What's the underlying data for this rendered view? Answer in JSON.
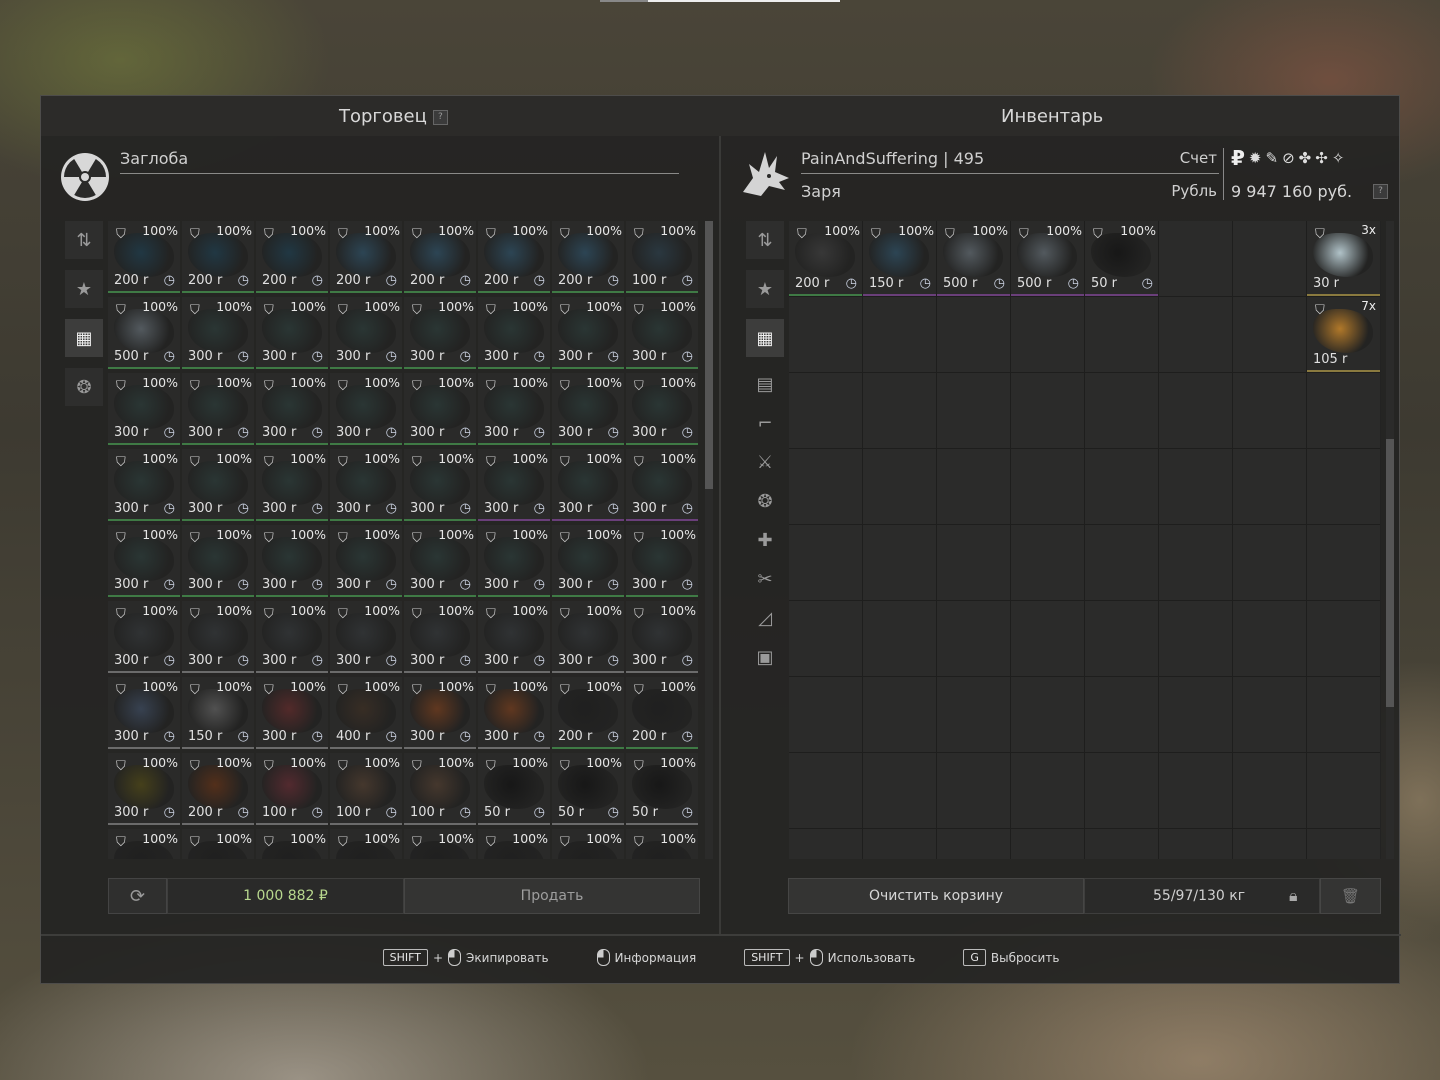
{
  "trader": {
    "title": "Торговец",
    "help": "?",
    "name": "Заглоба",
    "money": "1 000 882",
    "money_symbol": "₽",
    "sell_label": "Продать",
    "rows": [
      [
        {
          "c": "100%",
          "p": "200 r",
          "col": "#1f3a48",
          "b": "b-green"
        },
        {
          "c": "100%",
          "p": "200 r",
          "col": "#1f3a48",
          "b": "b-green"
        },
        {
          "c": "100%",
          "p": "200 r",
          "col": "#1f3a48",
          "b": "b-green"
        },
        {
          "c": "100%",
          "p": "200 r",
          "col": "#2d4a5c",
          "b": "b-green"
        },
        {
          "c": "100%",
          "p": "200 r",
          "col": "#2d4a5c",
          "b": "b-green"
        },
        {
          "c": "100%",
          "p": "200 r",
          "col": "#2d4a5c",
          "b": "b-green"
        },
        {
          "c": "100%",
          "p": "200 r",
          "col": "#2d4a5c",
          "b": "b-green"
        },
        {
          "c": "100%",
          "p": "100 r",
          "col": "#2a3a44",
          "b": "b-green"
        }
      ],
      [
        {
          "c": "100%",
          "p": "500 r",
          "col": "#5a6268",
          "b": "b-green"
        },
        {
          "c": "100%",
          "p": "300 r",
          "col": "#2a3836",
          "b": "b-green"
        },
        {
          "c": "100%",
          "p": "300 r",
          "col": "#2a3836",
          "b": "b-green"
        },
        {
          "c": "100%",
          "p": "300 r",
          "col": "#2a3836",
          "b": "b-green"
        },
        {
          "c": "100%",
          "p": "300 r",
          "col": "#2a3836",
          "b": "b-green"
        },
        {
          "c": "100%",
          "p": "300 r",
          "col": "#2a3836",
          "b": "b-green"
        },
        {
          "c": "100%",
          "p": "300 r",
          "col": "#2a3836",
          "b": "b-green"
        },
        {
          "c": "100%",
          "p": "300 r",
          "col": "#2a3836",
          "b": "b-green"
        }
      ],
      [
        {
          "c": "100%",
          "p": "300 r",
          "col": "#2a3836",
          "b": "b-green"
        },
        {
          "c": "100%",
          "p": "300 r",
          "col": "#2a3836",
          "b": "b-green"
        },
        {
          "c": "100%",
          "p": "300 r",
          "col": "#2a3836",
          "b": "b-green"
        },
        {
          "c": "100%",
          "p": "300 r",
          "col": "#2a3836",
          "b": "b-green"
        },
        {
          "c": "100%",
          "p": "300 r",
          "col": "#2a3836",
          "b": "b-green"
        },
        {
          "c": "100%",
          "p": "300 r",
          "col": "#2a3836",
          "b": "b-green"
        },
        {
          "c": "100%",
          "p": "300 r",
          "col": "#2a3836",
          "b": "b-green"
        },
        {
          "c": "100%",
          "p": "300 r",
          "col": "#2a3836",
          "b": "b-green"
        }
      ],
      [
        {
          "c": "100%",
          "p": "300 r",
          "col": "#2a3836",
          "b": "b-green"
        },
        {
          "c": "100%",
          "p": "300 r",
          "col": "#2a3836",
          "b": "b-green"
        },
        {
          "c": "100%",
          "p": "300 r",
          "col": "#2a3836",
          "b": "b-green"
        },
        {
          "c": "100%",
          "p": "300 r",
          "col": "#2a3836",
          "b": "b-green"
        },
        {
          "c": "100%",
          "p": "300 r",
          "col": "#2a3836",
          "b": "b-green"
        },
        {
          "c": "100%",
          "p": "300 r",
          "col": "#2a3836",
          "b": "b-purple"
        },
        {
          "c": "100%",
          "p": "300 r",
          "col": "#2a3836",
          "b": "b-purple"
        },
        {
          "c": "100%",
          "p": "300 r",
          "col": "#2a3836",
          "b": "b-purple"
        }
      ],
      [
        {
          "c": "100%",
          "p": "300 r",
          "col": "#2a3836",
          "b": "b-green"
        },
        {
          "c": "100%",
          "p": "300 r",
          "col": "#2a3836",
          "b": "b-green"
        },
        {
          "c": "100%",
          "p": "300 r",
          "col": "#2a3836",
          "b": "b-green"
        },
        {
          "c": "100%",
          "p": "300 r",
          "col": "#2a3836",
          "b": "b-green"
        },
        {
          "c": "100%",
          "p": "300 r",
          "col": "#2a3836",
          "b": "b-green"
        },
        {
          "c": "100%",
          "p": "300 r",
          "col": "#2a3836",
          "b": "b-green"
        },
        {
          "c": "100%",
          "p": "300 r",
          "col": "#2a3836",
          "b": "b-green"
        },
        {
          "c": "100%",
          "p": "300 r",
          "col": "#2a3836",
          "b": "b-green"
        }
      ],
      [
        {
          "c": "100%",
          "p": "300 r",
          "col": "#313436",
          "b": ""
        },
        {
          "c": "100%",
          "p": "300 r",
          "col": "#313436",
          "b": ""
        },
        {
          "c": "100%",
          "p": "300 r",
          "col": "#313436",
          "b": ""
        },
        {
          "c": "100%",
          "p": "300 r",
          "col": "#313436",
          "b": ""
        },
        {
          "c": "100%",
          "p": "300 r",
          "col": "#313436",
          "b": ""
        },
        {
          "c": "100%",
          "p": "300 r",
          "col": "#313436",
          "b": ""
        },
        {
          "c": "100%",
          "p": "300 r",
          "col": "#313436",
          "b": ""
        },
        {
          "c": "100%",
          "p": "300 r",
          "col": "#313436",
          "b": ""
        }
      ],
      [
        {
          "c": "100%",
          "p": "300 r",
          "col": "#3a4658",
          "b": ""
        },
        {
          "c": "100%",
          "p": "150 r",
          "col": "#585858",
          "b": ""
        },
        {
          "c": "100%",
          "p": "300 r",
          "col": "#5a2a2a",
          "b": ""
        },
        {
          "c": "100%",
          "p": "400 r",
          "col": "#3a2e24",
          "b": ""
        },
        {
          "c": "100%",
          "p": "300 r",
          "col": "#6a3a1e",
          "b": ""
        },
        {
          "c": "100%",
          "p": "300 r",
          "col": "#6a3a1e",
          "b": ""
        },
        {
          "c": "100%",
          "p": "200 r",
          "col": "#1e1e1e",
          "b": "b-green"
        },
        {
          "c": "100%",
          "p": "200 r",
          "col": "#1e1e1e",
          "b": "b-green"
        }
      ],
      [
        {
          "c": "100%",
          "p": "300 r",
          "col": "#4a4418",
          "b": ""
        },
        {
          "c": "100%",
          "p": "200 r",
          "col": "#5a3018",
          "b": ""
        },
        {
          "c": "100%",
          "p": "100 r",
          "col": "#5a2a30",
          "b": ""
        },
        {
          "c": "100%",
          "p": "100 r",
          "col": "#4a3a2e",
          "b": ""
        },
        {
          "c": "100%",
          "p": "100 r",
          "col": "#4a3a2e",
          "b": ""
        },
        {
          "c": "100%",
          "p": "50 r",
          "col": "#141414",
          "b": ""
        },
        {
          "c": "100%",
          "p": "50 r",
          "col": "#141414",
          "b": ""
        },
        {
          "c": "100%",
          "p": "50 r",
          "col": "#141414",
          "b": ""
        }
      ],
      [
        {
          "c": "100%",
          "p": "",
          "col": "#1e1e1e",
          "b": ""
        },
        {
          "c": "100%",
          "p": "",
          "col": "#1e1e1e",
          "b": ""
        },
        {
          "c": "100%",
          "p": "",
          "col": "#1e1e1e",
          "b": ""
        },
        {
          "c": "100%",
          "p": "",
          "col": "#1e1e1e",
          "b": ""
        },
        {
          "c": "100%",
          "p": "",
          "col": "#1e1e1e",
          "b": ""
        },
        {
          "c": "100%",
          "p": "",
          "col": "#1e1e1e",
          "b": ""
        },
        {
          "c": "100%",
          "p": "",
          "col": "#1e1e1e",
          "b": ""
        },
        {
          "c": "100%",
          "p": "",
          "col": "#1e1e1e",
          "b": ""
        }
      ]
    ]
  },
  "inventory": {
    "title": "Инвентарь",
    "player": "PainAndSuffering | 495",
    "faction": "Заря",
    "account_label": "Счет",
    "currency_label": "Рубль",
    "balance": "9 947 160 руб.",
    "help": "?",
    "currency_icons": [
      "₽",
      "✹",
      "✎",
      "⊘",
      "✤",
      "✣",
      "✧"
    ],
    "items": [
      {
        "slot": 0,
        "c": "100%",
        "p": "200 r",
        "col": "#3a3a3a",
        "b": "b-green"
      },
      {
        "slot": 1,
        "c": "100%",
        "p": "150 r",
        "col": "#2d4a5c",
        "b": "b-purple"
      },
      {
        "slot": 2,
        "c": "100%",
        "p": "500 r",
        "col": "#5a6268",
        "b": "b-purple"
      },
      {
        "slot": 3,
        "c": "100%",
        "p": "500 r",
        "col": "#5a6268",
        "b": "b-purple"
      },
      {
        "slot": 4,
        "c": "100%",
        "p": "50 r",
        "col": "#141414",
        "b": "b-purple"
      },
      {
        "slot": 7,
        "q": "3x",
        "p": "30 r",
        "col": "#c8dde4",
        "b": "b-yellow"
      },
      {
        "slot": 15,
        "q": "7x",
        "p": "105 r",
        "col": "#c8862a",
        "b": "b-yellow"
      }
    ],
    "clear_label": "Очистить корзину",
    "weight": "55/97/130 кг"
  },
  "hints": [
    {
      "key": "SHIFT",
      "plus": "+",
      "mouse": true,
      "label": "Экипировать"
    },
    {
      "key": "",
      "plus": "",
      "mouse": true,
      "label": "Информация"
    },
    {
      "key": "SHIFT",
      "plus": "+",
      "mouse": true,
      "label": "Использовать"
    },
    {
      "key": "G",
      "plus": "",
      "mouse": false,
      "label": "Выбросить"
    }
  ]
}
